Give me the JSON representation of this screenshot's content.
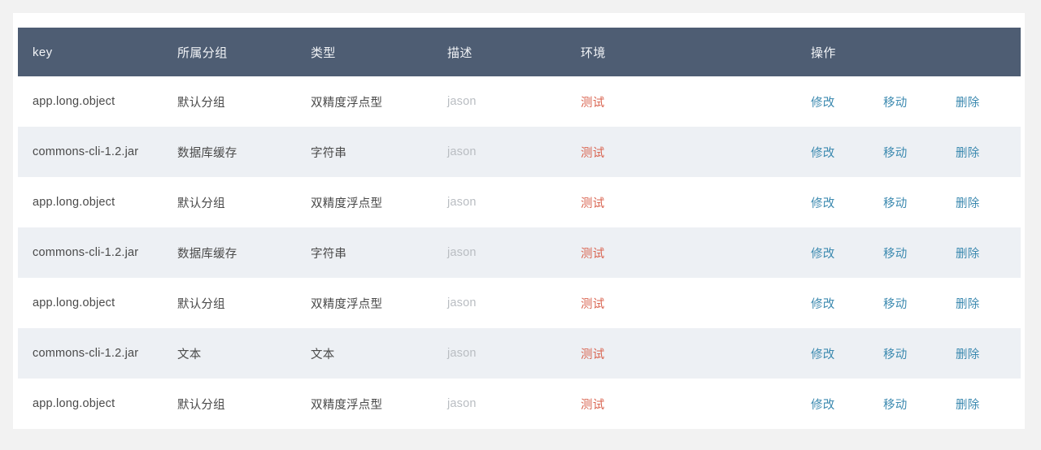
{
  "table": {
    "columns": [
      {
        "id": "key",
        "label": "key"
      },
      {
        "id": "group",
        "label": "所属分组"
      },
      {
        "id": "type",
        "label": "类型"
      },
      {
        "id": "desc",
        "label": "描述"
      },
      {
        "id": "env",
        "label": "环境"
      },
      {
        "id": "actions",
        "label": "操作"
      }
    ],
    "actions": [
      {
        "id": "edit",
        "label": "修改"
      },
      {
        "id": "move",
        "label": "移动"
      },
      {
        "id": "delete",
        "label": "删除"
      }
    ],
    "rows": [
      {
        "key": "app.long.object",
        "group": "默认分组",
        "type": "双精度浮点型",
        "desc": "jason",
        "env": "测试"
      },
      {
        "key": "commons-cli-1.2.jar",
        "group": "数据库缓存",
        "type": "字符串",
        "desc": "jason",
        "env": "测试"
      },
      {
        "key": "app.long.object",
        "group": "默认分组",
        "type": "双精度浮点型",
        "desc": "jason",
        "env": "测试"
      },
      {
        "key": "commons-cli-1.2.jar",
        "group": "数据库缓存",
        "type": "字符串",
        "desc": "jason",
        "env": "测试"
      },
      {
        "key": "app.long.object",
        "group": "默认分组",
        "type": "双精度浮点型",
        "desc": "jason",
        "env": "测试"
      },
      {
        "key": "commons-cli-1.2.jar",
        "group": "文本",
        "type": "文本",
        "desc": "jason",
        "env": "测试"
      },
      {
        "key": "app.long.object",
        "group": "默认分组",
        "type": "双精度浮点型",
        "desc": "jason",
        "env": "测试"
      }
    ]
  },
  "colors": {
    "page_background": "#f2f2f2",
    "card_background": "#ffffff",
    "header_background": "#4e5d73",
    "header_text": "#f2f4f7",
    "row_striped_background": "#edf0f4",
    "cell_text": "#4a4a4a",
    "description_text": "#b9bdc2",
    "environment_text": "#d9634f",
    "action_link": "#3d8ab0"
  }
}
